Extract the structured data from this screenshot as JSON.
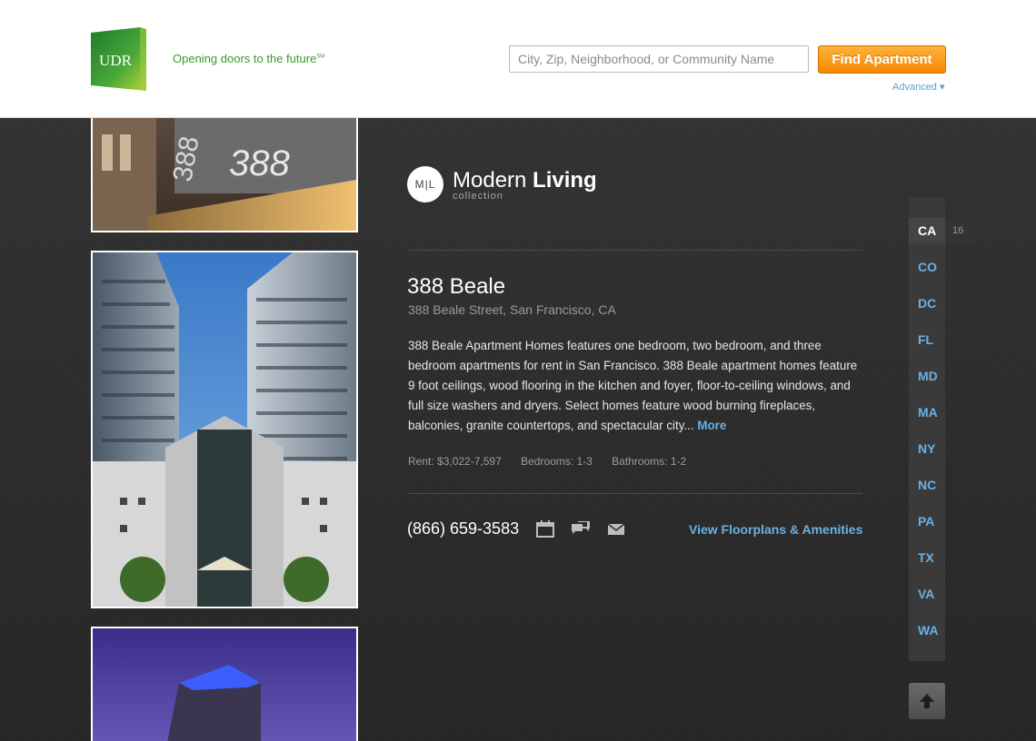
{
  "header": {
    "logo_text": "UDR",
    "tagline": "Opening doors to the future",
    "tagline_mark": "SM",
    "search_placeholder": "City, Zip, Neighborhood, or Community Name",
    "find_button": "Find Apartment",
    "advanced_link": "Advanced ▾"
  },
  "collection": {
    "monogram": "M|L",
    "title_light": "Modern",
    "title_bold": "Living",
    "subtitle": "collection"
  },
  "property": {
    "name": "388 Beale",
    "address": "388 Beale Street, San Francisco, CA",
    "description": "388 Beale Apartment Homes features one bedroom, two bedroom, and three bedroom apartments for rent in San Francisco. 388 Beale apartment homes feature 9 foot ceilings, wood flooring in the kitchen and foyer, floor-to-ceiling windows, and full size washers and dryers. Select homes feature wood burning fireplaces, balconies, granite countertops, and spectacular city...",
    "more_link": "More",
    "rent": "Rent: $3,022-7,597",
    "bedrooms": "Bedrooms: 1-3",
    "bathrooms": "Bathrooms: 1-2",
    "phone": "(866) 659-3583",
    "view_link": "View Floorplans & Amenities"
  },
  "states": {
    "items": [
      "CA",
      "CO",
      "DC",
      "FL",
      "MD",
      "MA",
      "NY",
      "NC",
      "PA",
      "TX",
      "VA",
      "WA"
    ],
    "active": "CA",
    "active_count": "16"
  },
  "colors": {
    "brand_green": "#3a9a2c",
    "accent_orange": "#f58a00",
    "link_blue": "#6ab1e4",
    "background_dark": "#2b2b2b"
  },
  "icons": [
    "calendar-icon",
    "chat-icon",
    "mail-icon",
    "up-arrow-icon"
  ]
}
